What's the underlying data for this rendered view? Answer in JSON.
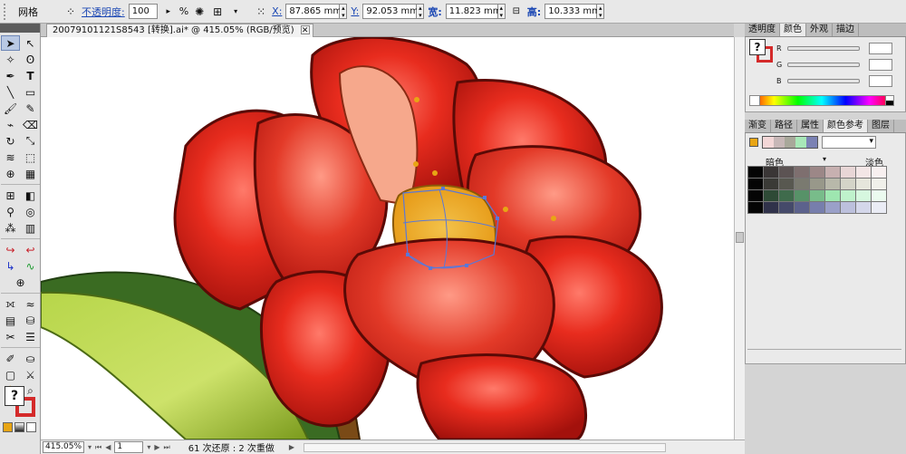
{
  "control_bar": {
    "mode_label": "网格",
    "opacity_label": "不透明度:",
    "opacity_value": "100",
    "opacity_unit": "%",
    "x_label": "X:",
    "x_value": "87.865 mm",
    "y_label": "Y:",
    "y_value": "92.053 mm",
    "width_label": "宽:",
    "width_value": "11.823 mm",
    "height_label": "高:",
    "height_value": "10.333 mm"
  },
  "document": {
    "tab_title": "20079101121S8543 [转换].ai* @ 415.05% (RGB/预览)",
    "close_icon": "close-icon"
  },
  "status_bar": {
    "zoom_value": "415.05%",
    "page_value": "1",
    "history_text": "61 次还原 : 2 次重做"
  },
  "panels": {
    "top_tabs": [
      "透明度",
      "颜色",
      "外观",
      "描边"
    ],
    "active_top_tab": "颜色",
    "sliders": [
      "R",
      "G",
      "B"
    ],
    "bottom_tabs": [
      "渐变",
      "路径",
      "属性",
      "颜色参考",
      "图层"
    ],
    "active_bottom_tab": "颜色参考",
    "guide_shade_label": "暗色",
    "guide_tint_label": "淡色"
  },
  "colors": {
    "accent_link": "#1c48b4",
    "base_color": "#e8a514",
    "stroke_red": "#d42a2a"
  },
  "guide_strip": [
    "#f3d7d7",
    "#c7b7b7",
    "#a8a89a",
    "#a8e8b8",
    "#7b82b4"
  ],
  "swatch_grid": [
    [
      "#050505",
      "#3a3636",
      "#5c5353",
      "#7e6f6f",
      "#9c8787",
      "#c7b0b0",
      "#e8d6d6",
      "#f3e6e6",
      "#f8f0f0"
    ],
    [
      "#050505",
      "#3a3a36",
      "#585850",
      "#7a7a70",
      "#98988a",
      "#b8b8aa",
      "#d4d4c8",
      "#e6e6dc",
      "#f0f0ea"
    ],
    [
      "#050505",
      "#2e4a36",
      "#3f6b4c",
      "#579268",
      "#78bc8a",
      "#9ee6b0",
      "#bff2cc",
      "#d6f7df",
      "#ebfbef"
    ],
    [
      "#050505",
      "#30324a",
      "#454a6a",
      "#5c628c",
      "#777eac",
      "#9aa0c8",
      "#bcc0dc",
      "#d4d7ea",
      "#eaecf5"
    ]
  ]
}
